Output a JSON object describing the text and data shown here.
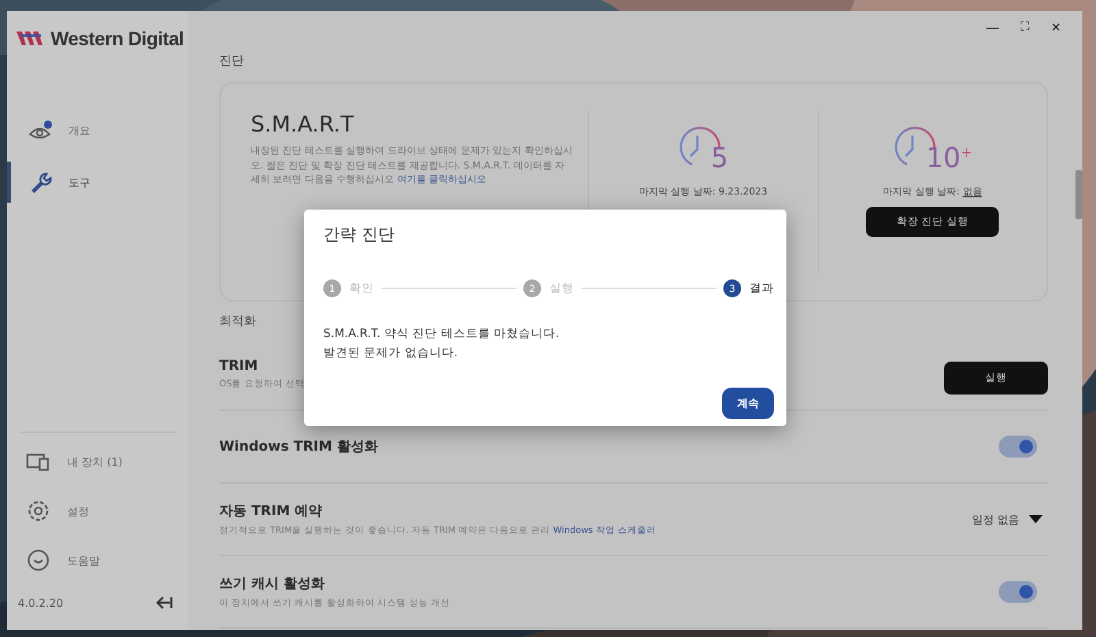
{
  "window": {
    "logo": "Western Digital",
    "controls": [
      "—",
      "⛶",
      "✕"
    ]
  },
  "sidebar": {
    "items": [
      {
        "label": "개요",
        "kind": "overview",
        "selected": false
      },
      {
        "label": "도구",
        "kind": "tools",
        "selected": true
      }
    ],
    "bottom_items": [
      {
        "label": "내 장치 (1)",
        "kind": "devices"
      },
      {
        "label": "설정",
        "kind": "settings"
      },
      {
        "label": "도움말",
        "kind": "help"
      }
    ],
    "version": "4.0.2.20"
  },
  "diagnostics": {
    "heading": "진단",
    "title": "S.M.A.R.T",
    "description": "내장된 진단 테스트를 실행하여 드라이브 상태에 문제가 있는지 확인하십시오. 짧은 진단 및 확장 진단 테스트를 제공합니다. S.M.A.R.T. 데이터를 자세히 보려면 다음을 수행하십시오 ",
    "link": "여기를 클릭하십시오",
    "tests": [
      {
        "number": "5",
        "last_run_label": "마지막 실행 날짜: 9.23.2023"
      },
      {
        "number": "10$^{+}$",
        "last_run_label": "마지막 실행 날짜: ",
        "last_run_value": "없음",
        "button": "확장 진단 실행"
      }
    ]
  },
  "optimization": {
    "heading": "최적화",
    "rows": [
      {
        "kind": "button",
        "title": "TRIM",
        "description": "OS를 요청하여 선택",
        "button": "실행"
      },
      {
        "kind": "toggle",
        "title": "Windows TRIM 활성화",
        "on": true
      },
      {
        "kind": "dropdown",
        "title": "자동 TRIM 예약",
        "description": "정기적으로 TRIM을 실행하는 것이 좋습니다. 자동 TRIM 예약은 다음으로 관리 ",
        "link": "Windows 작업 스케줄러",
        "value": "일정 없음"
      },
      {
        "kind": "toggle",
        "title": "쓰기 캐시 활성화",
        "description": "이 장치에서 쓰기 캐시를 활성화하여 시스템 성능 개선",
        "on": true
      }
    ]
  },
  "dialog": {
    "title": "간략 진단",
    "steps": [
      {
        "number": "1",
        "label": "확인",
        "selected": false
      },
      {
        "number": "2",
        "label": "실행",
        "selected": false
      },
      {
        "number": "3",
        "label": "결과",
        "selected": true
      }
    ],
    "message": [
      "S.M.A.R.T. 약식 진단 테스트를 마쳤습니다.",
      "발견된 문제가 없습니다."
    ],
    "button": "계속"
  }
}
